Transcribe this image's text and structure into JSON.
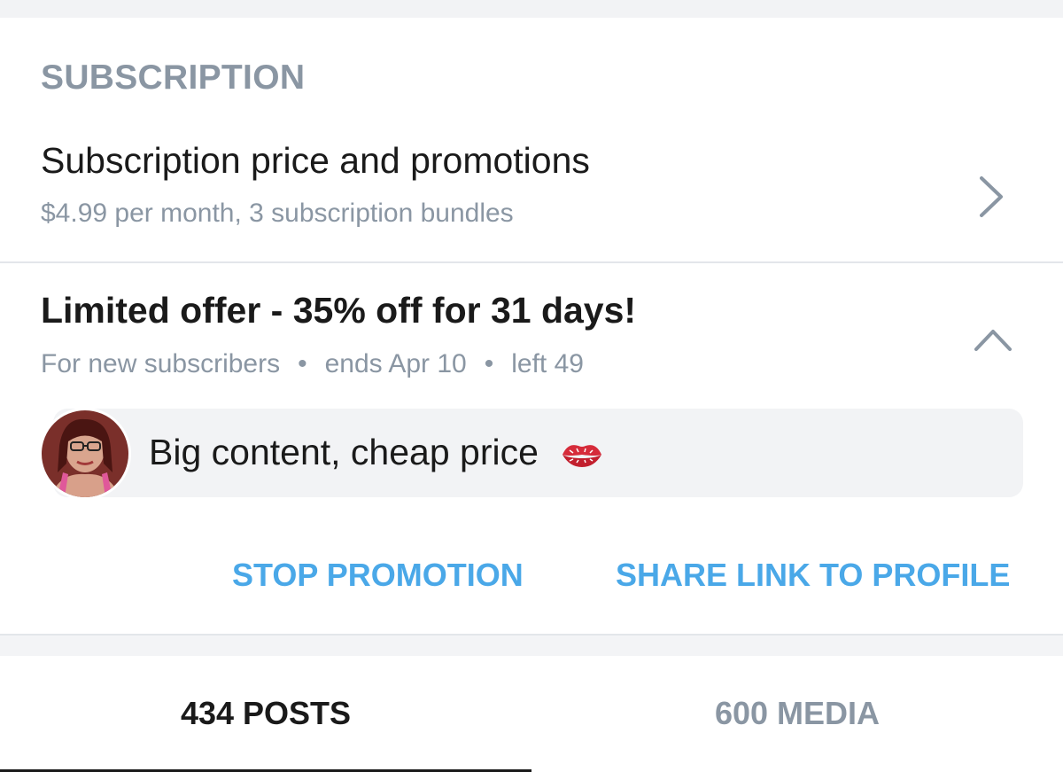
{
  "section": {
    "header": "SUBSCRIPTION"
  },
  "subscription_row": {
    "title": "Subscription price and promotions",
    "subtitle": "$4.99 per month, 3 subscription bundles",
    "icon": "chevron-right-icon"
  },
  "promotion": {
    "title": "Limited offer - 35% off for 31 days!",
    "audience": "For new subscribers",
    "ends": "ends Apr 10",
    "left": "left 49",
    "separator": "•",
    "collapse_icon": "chevron-up-icon",
    "message": "Big content, cheap price",
    "message_emoji": "kiss-mark-icon",
    "stop_label": "STOP PROMOTION",
    "share_label": "SHARE LINK TO PROFILE"
  },
  "tabs": [
    {
      "label": "434 POSTS",
      "active": true
    },
    {
      "label": "600 MEDIA",
      "active": false
    }
  ],
  "colors": {
    "accent": "#4aa8e8",
    "muted": "#8a96a3",
    "text": "#1a1a1a",
    "emoji_red": "#d62b3a"
  }
}
